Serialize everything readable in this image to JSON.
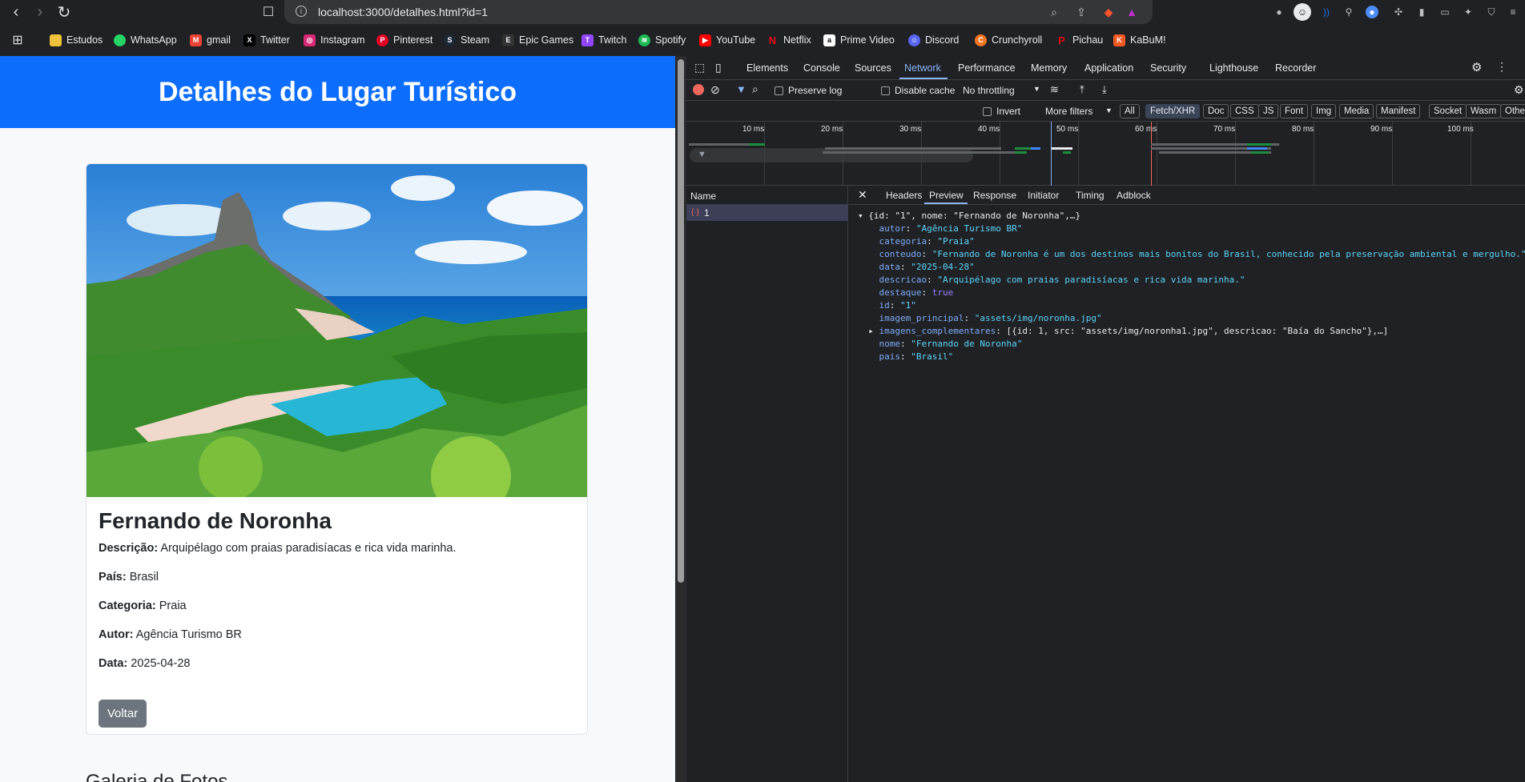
{
  "browser": {
    "url": "localhost:3000/detalhes.html?id=1",
    "bookmarks": [
      "Estudos",
      "WhatsApp",
      "gmail",
      "Twitter",
      "Instagram",
      "Pinterest",
      "Steam",
      "Epic Games",
      "Twitch",
      "Spotify",
      "YouTube",
      "Netflix",
      "Prime Video",
      "Discord",
      "Crunchyroll",
      "Pichau",
      "KaBuM!"
    ],
    "bookmark_colors": [
      "#f0c23b",
      "#25d366",
      "#ea4335",
      "#000000",
      "#d62976",
      "#e60023",
      "#1b2838",
      "#333333",
      "#9146ff",
      "#1db954",
      "#ff0000",
      "#e50914",
      "#00a8e1",
      "#5865f2",
      "#f47521",
      "#e30613",
      "#f15a22"
    ]
  },
  "page": {
    "header_title": "Detalhes do Lugar Turístico",
    "place_name": "Fernando de Noronha",
    "fields": [
      {
        "label": "Descrição:",
        "value": "Arquipélago com praias paradisíacas e rica vida marinha."
      },
      {
        "label": "País:",
        "value": "Brasil"
      },
      {
        "label": "Categoria:",
        "value": "Praia"
      },
      {
        "label": "Autor:",
        "value": "Agência Turismo BR"
      },
      {
        "label": "Data:",
        "value": "2025-04-28"
      }
    ],
    "back_button": "Voltar",
    "gallery_title": "Galeria de Fotos"
  },
  "devtools": {
    "tabs": [
      "Elements",
      "Console",
      "Sources",
      "Network",
      "Performance",
      "Memory",
      "Application",
      "Security",
      "Lighthouse",
      "Recorder"
    ],
    "active_tab": "Network",
    "preserve_log": "Preserve log",
    "disable_cache": "Disable cache",
    "throttling": "No throttling",
    "invert": "Invert",
    "more_filters": "More filters",
    "filter_chips": [
      "All",
      "Fetch/XHR",
      "Doc",
      "CSS",
      "JS",
      "Font",
      "Img",
      "Media",
      "Manifest",
      "Socket",
      "Wasm",
      "Othe"
    ],
    "active_filter": "Fetch/XHR",
    "timeline_ticks": [
      "10 ms",
      "20 ms",
      "30 ms",
      "40 ms",
      "50 ms",
      "60 ms",
      "70 ms",
      "80 ms",
      "90 ms",
      "100 ms"
    ],
    "name_header": "Name",
    "request_name": "1",
    "detail_tabs": [
      "Headers",
      "Preview",
      "Response",
      "Initiator",
      "Timing",
      "Adblock"
    ],
    "active_detail_tab": "Preview",
    "preview": {
      "summary": "{id: \"1\", nome: \"Fernando de Noronha\",…}",
      "autor": "\"Agência Turismo BR\"",
      "categoria": "\"Praia\"",
      "conteudo": "\"Fernando de Noronha é um dos destinos mais bonitos do Brasil, conhecido pela preservação ambiental e mergulho.\"",
      "data": "\"2025-04-28\"",
      "descricao": "\"Arquipélago com praias paradisíacas e rica vida marinha.\"",
      "destaque": "true",
      "id": "\"1\"",
      "imagem_principal": "\"assets/img/noronha.jpg\"",
      "imagens_complementares": "[{id: 1, src: \"assets/img/noronha1.jpg\", descricao: \"Baía do Sancho\"},…]",
      "nome": "\"Fernando de Noronha\"",
      "pais": "\"Brasil\""
    }
  }
}
